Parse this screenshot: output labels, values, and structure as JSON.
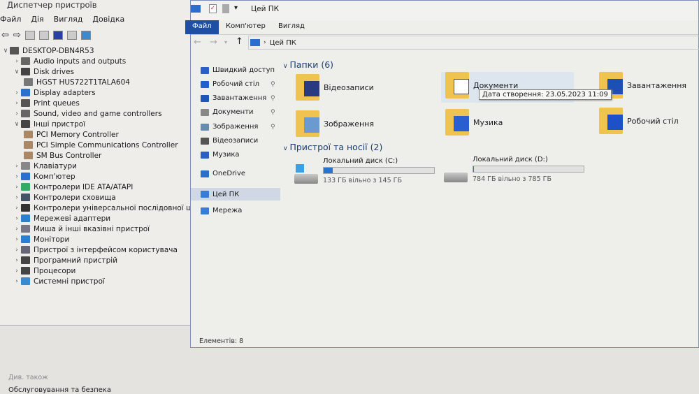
{
  "device_manager": {
    "title": "Диспетчер пристроїв",
    "menu": [
      "Файл",
      "Дія",
      "Вигляд",
      "Довідка"
    ],
    "tree": [
      {
        "label": "DESKTOP-DBN4R53",
        "level": 0,
        "expanded": true
      },
      {
        "label": "Audio inputs and outputs",
        "level": 1,
        "expanded": false
      },
      {
        "label": "Disk drives",
        "level": 1,
        "expanded": true
      },
      {
        "label": "HGST HUS722T1TALA604",
        "level": 2
      },
      {
        "label": "Display adapters",
        "level": 1,
        "expanded": false
      },
      {
        "label": "Print queues",
        "level": 1,
        "expanded": false
      },
      {
        "label": "Sound, video and game controllers",
        "level": 1,
        "expanded": false
      },
      {
        "label": "Інші пристрої",
        "level": 1,
        "expanded": true
      },
      {
        "label": "PCI Memory Controller",
        "level": 2,
        "warning": true
      },
      {
        "label": "PCI Simple Communications Controller",
        "level": 2,
        "warning": true
      },
      {
        "label": "SM Bus Controller",
        "level": 2,
        "warning": true
      },
      {
        "label": "Клавіатури",
        "level": 1,
        "expanded": false
      },
      {
        "label": "Комп'ютер",
        "level": 1,
        "expanded": false
      },
      {
        "label": "Контролери IDE ATA/ATAPI",
        "level": 1,
        "expanded": false
      },
      {
        "label": "Контролери сховища",
        "level": 1,
        "expanded": false
      },
      {
        "label": "Контролери універсальної послідовної шини",
        "level": 1,
        "expanded": false
      },
      {
        "label": "Мережеві адаптери",
        "level": 1,
        "expanded": false
      },
      {
        "label": "Миша й інші вказівні пристрої",
        "level": 1,
        "expanded": false
      },
      {
        "label": "Монітори",
        "level": 1,
        "expanded": false
      },
      {
        "label": "Пристрої з інтерфейсом користувача",
        "level": 1,
        "expanded": false
      },
      {
        "label": "Програмний пристрій",
        "level": 1,
        "expanded": false
      },
      {
        "label": "Процесори",
        "level": 1,
        "expanded": false
      },
      {
        "label": "Системні пристрої",
        "level": 1,
        "expanded": false
      }
    ]
  },
  "explorer": {
    "title": "Цей ПК",
    "tabs": [
      "Файл",
      "Комп'ютер",
      "Вигляд"
    ],
    "address": "Цей ПК",
    "nav": [
      {
        "label": "Швидкий доступ",
        "color": "#2b5fc7"
      },
      {
        "label": "Робочий стіл",
        "color": "#1f5fd0",
        "pinned": true
      },
      {
        "label": "Завантаження",
        "color": "#1d55b8",
        "pinned": true
      },
      {
        "label": "Документи",
        "color": "#888888",
        "pinned": true
      },
      {
        "label": "Зображення",
        "color": "#6a8bb0",
        "pinned": true
      },
      {
        "label": "Відеозаписи",
        "color": "#555555"
      },
      {
        "label": "Музика",
        "color": "#2d5fc0"
      },
      {
        "label": "OneDrive",
        "color": "#2a6fc9"
      },
      {
        "label": "Цей ПК",
        "color": "#3a7bd5",
        "selected": true
      },
      {
        "label": "Мережа",
        "color": "#3a7bd5"
      }
    ],
    "folders_header": "Папки (6)",
    "folders": [
      {
        "label": "Відеозаписи",
        "icon": "video-icon"
      },
      {
        "label": "Документи",
        "icon": "document-icon",
        "hovered": true
      },
      {
        "label": "Завантаження",
        "icon": "download-arrow-icon"
      },
      {
        "label": "Зображення",
        "icon": "picture-icon"
      },
      {
        "label": "Музика",
        "icon": "music-note-icon"
      },
      {
        "label": "Робочий стіл",
        "icon": "desktop-icon"
      }
    ],
    "tooltip": "Дата створення: 23.05.2023 11:09",
    "devices_header": "Пристрої та носії (2)",
    "drives": [
      {
        "label": "Локальний диск (C:)",
        "free": "133 ГБ вільно з 145 ГБ",
        "used_percent": 8.3
      },
      {
        "label": "Локальний диск (D:)",
        "free": "784 ГБ вільно з 785 ГБ",
        "used_percent": 0.1
      }
    ],
    "status": "Елементів: 8",
    "pin_glyph": "📌"
  },
  "background": {
    "see_also": "Див. також",
    "link": "Обслуговування та безпека"
  }
}
